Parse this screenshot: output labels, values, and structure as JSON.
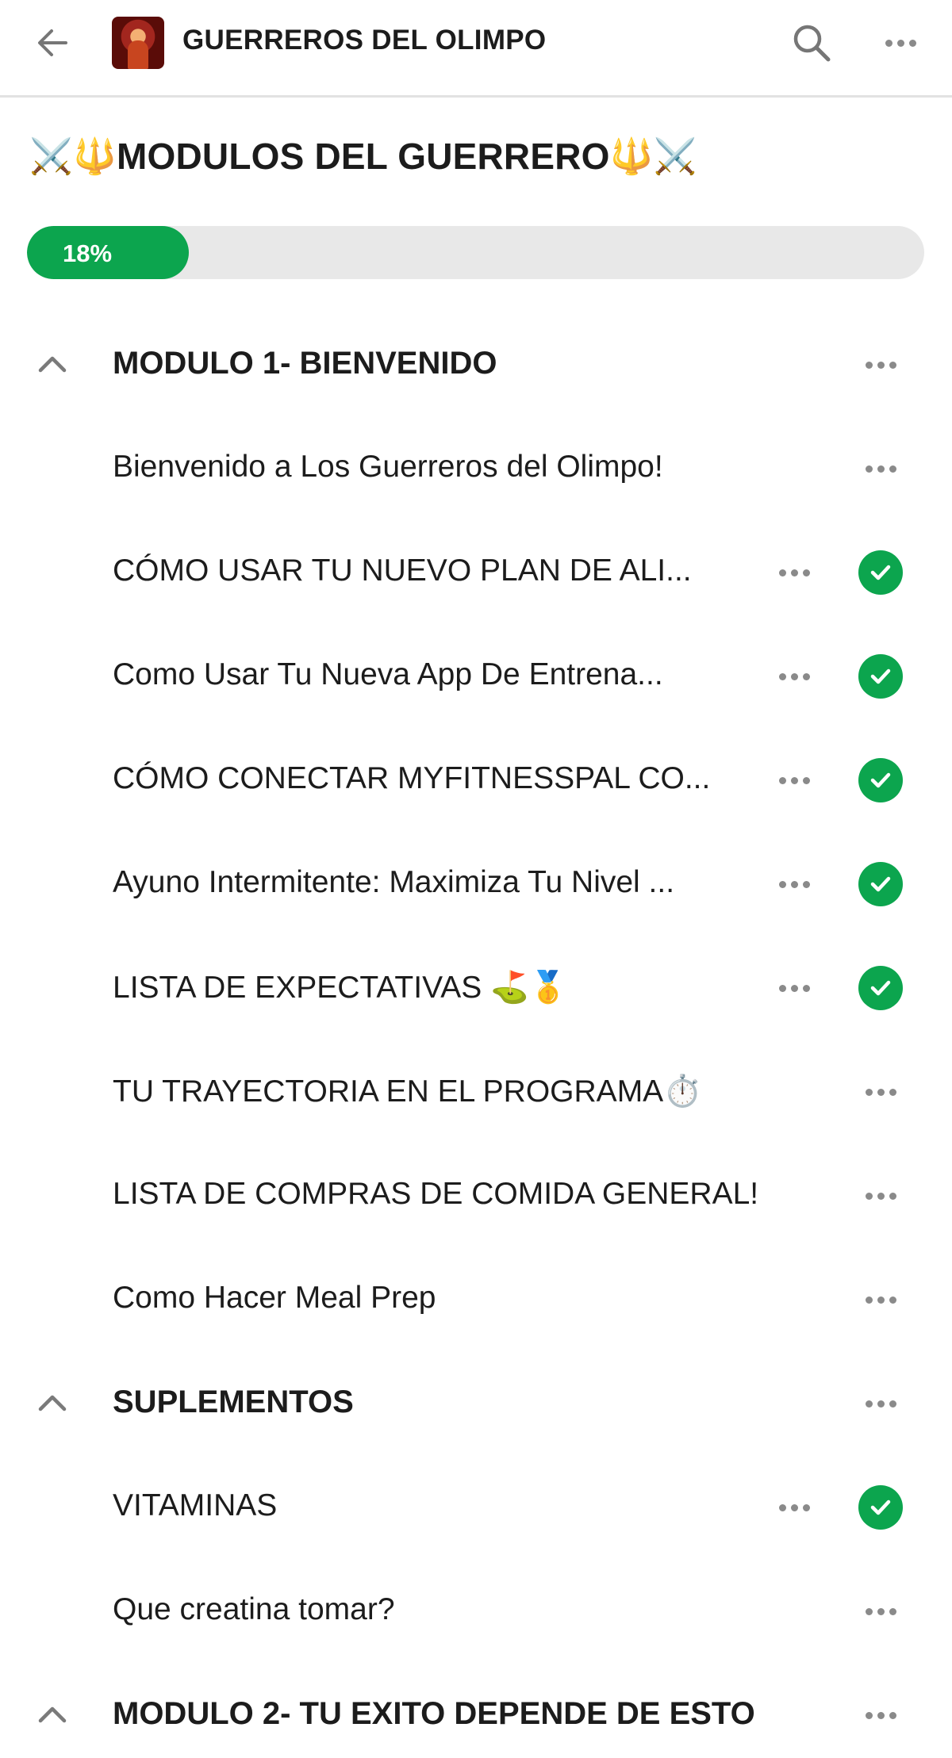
{
  "header": {
    "group_name": "GUERREROS DEL OLIMPO",
    "icons": {
      "back": "arrow-left-icon",
      "search": "search-icon",
      "more": "more-horizontal-icon"
    }
  },
  "page_title": {
    "left_emoji": "⚔️🔱",
    "text": "MODULOS DEL GUERRERO",
    "right_emoji": "🔱⚔️"
  },
  "progress": {
    "label": "18%",
    "value": 0.18,
    "color": "#0ca54e"
  },
  "sections": [
    {
      "title": "MODULO 1- BIENVENIDO",
      "expanded": true,
      "lessons": [
        {
          "title": "Bienvenido a Los Guerreros del Olimpo!",
          "completed": false
        },
        {
          "title": "CÓMO USAR TU NUEVO PLAN DE ALI...",
          "completed": true
        },
        {
          "title": "Como Usar Tu Nueva App De Entrena...",
          "completed": true
        },
        {
          "title": "CÓMO CONECTAR MYFITNESSPAL CO...",
          "completed": true
        },
        {
          "title": "Ayuno Intermitente: Maximiza Tu Nivel ...",
          "completed": true
        },
        {
          "title": "LISTA DE EXPECTATIVAS ⛳🥇",
          "completed": true
        },
        {
          "title": "TU TRAYECTORIA EN EL PROGRAMA⏱️",
          "completed": false
        },
        {
          "title": "LISTA DE COMPRAS DE COMIDA GENERAL!",
          "completed": false
        },
        {
          "title": "Como Hacer Meal Prep",
          "completed": false
        }
      ]
    },
    {
      "title": "SUPLEMENTOS",
      "expanded": true,
      "lessons": [
        {
          "title": "VITAMINAS",
          "completed": true
        },
        {
          "title": "Que creatina tomar?",
          "completed": false
        }
      ]
    },
    {
      "title": "MODULO 2- TU EXITO DEPENDE DE ESTO",
      "expanded": true,
      "lessons": []
    }
  ],
  "colors": {
    "accent": "#0ca54e",
    "track": "#e8e8e8",
    "divider": "#e2e2e2"
  }
}
